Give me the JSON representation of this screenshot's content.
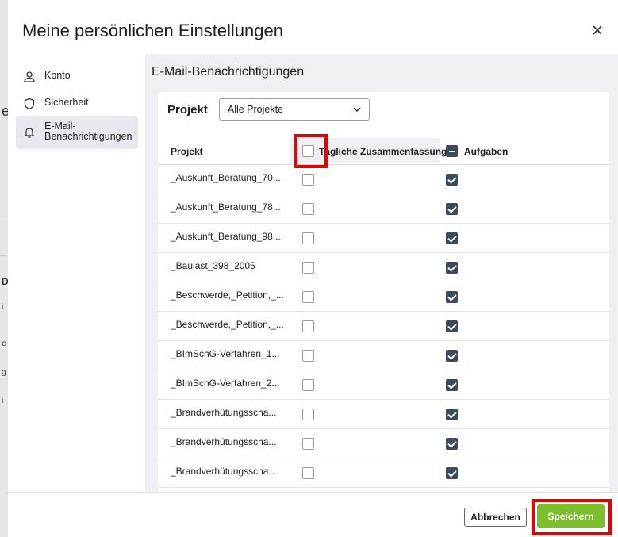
{
  "dialog": {
    "title": "Meine persönlichen Einstellungen",
    "close_icon": "close-icon"
  },
  "sidebar": {
    "items": [
      {
        "label": "Konto",
        "icon": "user-icon",
        "active": false
      },
      {
        "label": "Sicherheit",
        "icon": "shield-icon",
        "active": false
      },
      {
        "label": "E-Mail-\nBenachrichtigungen",
        "icon": "bell-icon",
        "active": true
      }
    ]
  },
  "content": {
    "section_title": "E-Mail-Benachrichtigungen",
    "filter": {
      "label": "Projekt",
      "selected": "Alle Projekte",
      "icon": "chevron-down-icon"
    },
    "table": {
      "headers": [
        "Projekt",
        "Tägliche Zusammenfassung",
        "Aufgaben"
      ],
      "header_daily_checked": false,
      "header_tasks_state": "indeterminate",
      "rows": [
        {
          "name": "_Auskunft_Beratung_70...",
          "daily": false,
          "tasks": true
        },
        {
          "name": "_Auskunft_Beratung_78...",
          "daily": false,
          "tasks": true
        },
        {
          "name": "_Auskunft_Beratung_98...",
          "daily": false,
          "tasks": true
        },
        {
          "name": "_Baulast_398_2005",
          "daily": false,
          "tasks": true
        },
        {
          "name": "_Beschwerde,_Petition,_...",
          "daily": false,
          "tasks": true
        },
        {
          "name": "_Beschwerde,_Petition,_...",
          "daily": false,
          "tasks": true
        },
        {
          "name": "_BImSchG-Verfahren_1...",
          "daily": false,
          "tasks": true
        },
        {
          "name": "_BImSchG-Verfahren_2...",
          "daily": false,
          "tasks": true
        },
        {
          "name": "_Brandverhütungsscha...",
          "daily": false,
          "tasks": true
        },
        {
          "name": "_Brandverhütungsscha...",
          "daily": false,
          "tasks": true
        },
        {
          "name": "_Brandverhütungsscha...",
          "daily": false,
          "tasks": true
        }
      ]
    }
  },
  "footer": {
    "cancel_label": "Abbrechen",
    "save_label": "Speichern"
  },
  "colors": {
    "accent": "#7cbf2a",
    "checkbox_checked": "#3c4a5c",
    "highlight": "#e60000",
    "content_bg": "#eef0f3"
  },
  "background_fragments": [
    "e",
    "D",
    "i",
    "e",
    "g",
    "i"
  ]
}
